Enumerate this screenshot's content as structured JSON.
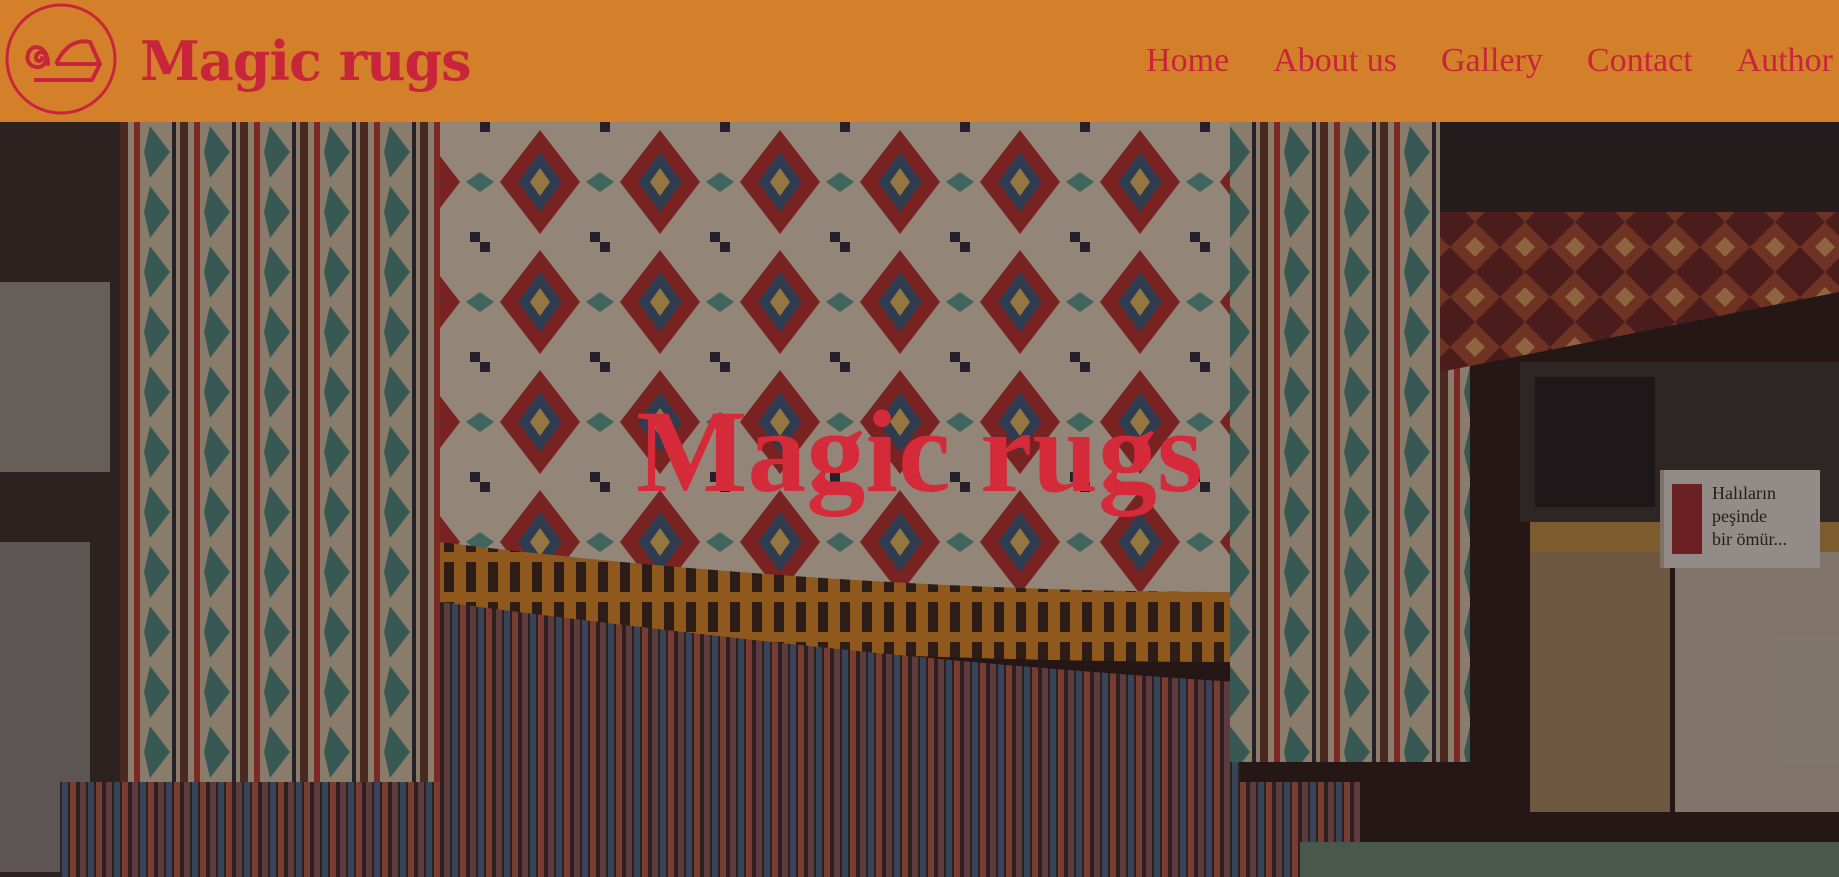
{
  "brand": {
    "name": "Magic rugs"
  },
  "nav": {
    "items": [
      "Home",
      "About us",
      "Gallery",
      "Contact",
      "Author"
    ]
  },
  "hero": {
    "title": "Magic rugs",
    "sign_lines": [
      "Halıların",
      "peşinde",
      "bir ömür..."
    ]
  },
  "colors": {
    "header_bg": "#d4802b",
    "brand_red": "#c9253a",
    "hero_title": "#d42a3a"
  },
  "icons": {
    "logo": "rolled-rug-icon"
  }
}
